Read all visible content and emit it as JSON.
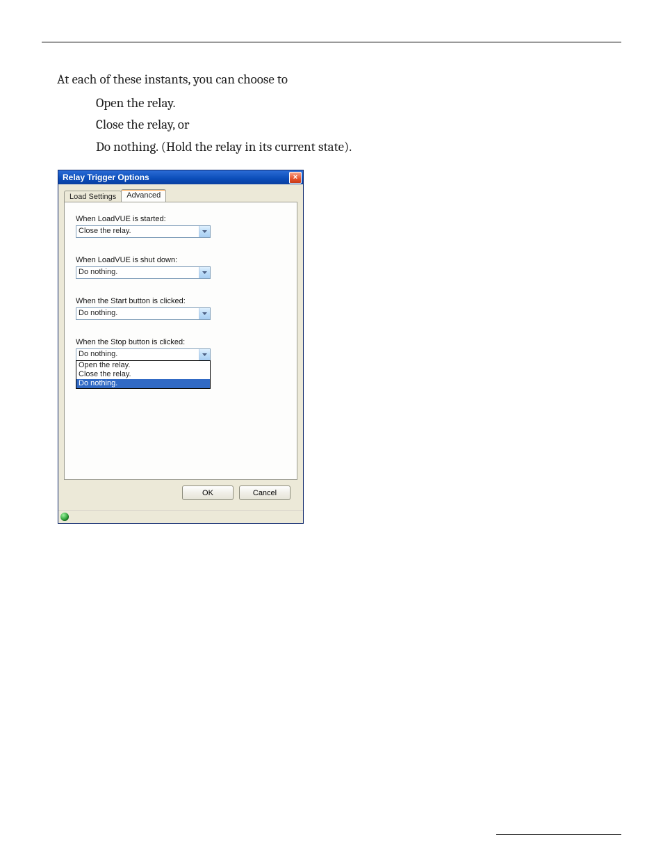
{
  "doc": {
    "intro": "At each of these instants, you can choose to",
    "bullets": [
      "Open the relay.",
      "Close the relay, or",
      "Do nothing. (Hold the relay in its current state)."
    ]
  },
  "dialog": {
    "title": "Relay Trigger Options",
    "tabs": {
      "load": "Load Settings",
      "advanced": "Advanced"
    },
    "fields": {
      "started": {
        "label": "When LoadVUE is started:",
        "value": "Close the relay."
      },
      "shutdown": {
        "label": "When LoadVUE is shut down:",
        "value": "Do nothing."
      },
      "start_btn": {
        "label": "When the Start button is clicked:",
        "value": "Do nothing."
      },
      "stop_btn": {
        "label": "When the Stop button is clicked:",
        "value": "Do nothing."
      }
    },
    "options": {
      "open": "Open the relay.",
      "close": "Close the relay.",
      "none": "Do nothing."
    },
    "buttons": {
      "ok": "OK",
      "cancel": "Cancel"
    }
  }
}
